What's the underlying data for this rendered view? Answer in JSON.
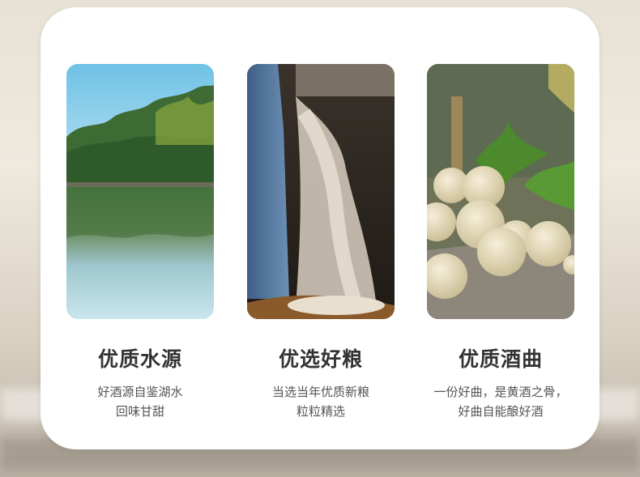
{
  "features": [
    {
      "title": "优质水源",
      "lines": [
        "好酒源自鉴湖水",
        "回味甘甜"
      ],
      "icon": "lake-photo"
    },
    {
      "title": "优选好粮",
      "lines": [
        "当选当年优质新粮",
        "粒粒精选"
      ],
      "icon": "grain-photo"
    },
    {
      "title": "优质酒曲",
      "lines": [
        "一份好曲，是黄酒之骨，",
        "好曲自能酿好酒"
      ],
      "icon": "yeast-balls-photo"
    }
  ],
  "colors": {
    "card": "#ffffff",
    "title": "#333333",
    "text": "#555555"
  }
}
